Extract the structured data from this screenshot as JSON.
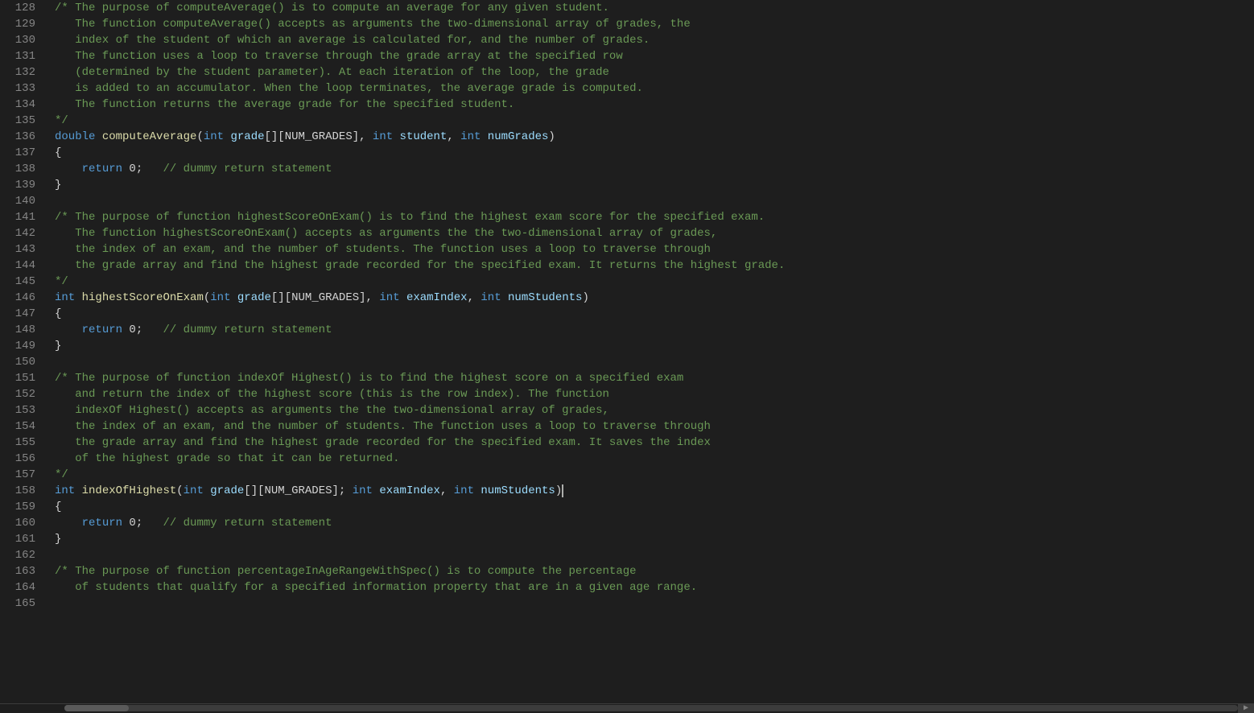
{
  "editor": {
    "background": "#1e1e1e",
    "lines": [
      {
        "num": "128",
        "tokens": [
          {
            "t": "comment",
            "v": "/* The purpose of computeAverage() is to compute an average for any given student."
          }
        ]
      },
      {
        "num": "129",
        "tokens": [
          {
            "t": "comment",
            "v": "   The function computeAverage() accepts as arguments the two-dimensional array of grades, the"
          }
        ]
      },
      {
        "num": "130",
        "tokens": [
          {
            "t": "comment",
            "v": "   index of the student of which an average is calculated for, and the number of grades."
          }
        ]
      },
      {
        "num": "131",
        "tokens": [
          {
            "t": "comment",
            "v": "   The function uses a loop to traverse through the grade array at the specified row"
          }
        ]
      },
      {
        "num": "132",
        "tokens": [
          {
            "t": "comment",
            "v": "   (determined by the student parameter). At each iteration of the loop, the grade"
          }
        ]
      },
      {
        "num": "133",
        "tokens": [
          {
            "t": "comment",
            "v": "   is added to an accumulator. When the loop terminates, the average grade is computed."
          }
        ]
      },
      {
        "num": "134",
        "tokens": [
          {
            "t": "comment",
            "v": "   The function returns the average grade for the specified student."
          }
        ]
      },
      {
        "num": "135",
        "tokens": [
          {
            "t": "comment",
            "v": "*/"
          }
        ]
      },
      {
        "num": "136",
        "tokens": [
          {
            "t": "keyword",
            "v": "double"
          },
          {
            "t": "plain",
            "v": " "
          },
          {
            "t": "function-name",
            "v": "computeAverage"
          },
          {
            "t": "plain",
            "v": "("
          },
          {
            "t": "keyword",
            "v": "int"
          },
          {
            "t": "plain",
            "v": " "
          },
          {
            "t": "param-name",
            "v": "grade"
          },
          {
            "t": "plain",
            "v": "[][NUM_GRADES], "
          },
          {
            "t": "keyword",
            "v": "int"
          },
          {
            "t": "plain",
            "v": " "
          },
          {
            "t": "param-name",
            "v": "student"
          },
          {
            "t": "plain",
            "v": ", "
          },
          {
            "t": "keyword",
            "v": "int"
          },
          {
            "t": "plain",
            "v": " "
          },
          {
            "t": "param-name",
            "v": "numGrades"
          },
          {
            "t": "plain",
            "v": ")"
          }
        ]
      },
      {
        "num": "137",
        "tokens": [
          {
            "t": "plain",
            "v": "{"
          }
        ]
      },
      {
        "num": "138",
        "tokens": [
          {
            "t": "plain",
            "v": "    "
          },
          {
            "t": "keyword",
            "v": "return"
          },
          {
            "t": "plain",
            "v": " 0;   "
          },
          {
            "t": "comment-inline",
            "v": "// dummy return statement"
          }
        ]
      },
      {
        "num": "139",
        "tokens": [
          {
            "t": "plain",
            "v": "}"
          }
        ]
      },
      {
        "num": "140",
        "tokens": []
      },
      {
        "num": "141",
        "tokens": [
          {
            "t": "comment",
            "v": "/* The purpose of function highestScoreOnExam() is to find the highest exam score for the specified exam."
          }
        ]
      },
      {
        "num": "142",
        "tokens": [
          {
            "t": "comment",
            "v": "   The function highestScoreOnExam() accepts as arguments the the two-dimensional array of grades,"
          }
        ]
      },
      {
        "num": "143",
        "tokens": [
          {
            "t": "comment",
            "v": "   the index of an exam, and the number of students. The function uses a loop to traverse through"
          }
        ]
      },
      {
        "num": "144",
        "tokens": [
          {
            "t": "comment",
            "v": "   the grade array and find the highest grade recorded for the specified exam. It returns the highest grade."
          }
        ]
      },
      {
        "num": "145",
        "tokens": [
          {
            "t": "comment",
            "v": "*/"
          }
        ]
      },
      {
        "num": "146",
        "tokens": [
          {
            "t": "keyword",
            "v": "int"
          },
          {
            "t": "plain",
            "v": " "
          },
          {
            "t": "function-name",
            "v": "highestScoreOnExam"
          },
          {
            "t": "plain",
            "v": "("
          },
          {
            "t": "keyword",
            "v": "int"
          },
          {
            "t": "plain",
            "v": " "
          },
          {
            "t": "param-name",
            "v": "grade"
          },
          {
            "t": "plain",
            "v": "[][NUM_GRADES], "
          },
          {
            "t": "keyword",
            "v": "int"
          },
          {
            "t": "plain",
            "v": " "
          },
          {
            "t": "param-name",
            "v": "examIndex"
          },
          {
            "t": "plain",
            "v": ", "
          },
          {
            "t": "keyword",
            "v": "int"
          },
          {
            "t": "plain",
            "v": " "
          },
          {
            "t": "param-name",
            "v": "numStudents"
          },
          {
            "t": "plain",
            "v": ")"
          }
        ]
      },
      {
        "num": "147",
        "tokens": [
          {
            "t": "plain",
            "v": "{"
          }
        ]
      },
      {
        "num": "148",
        "tokens": [
          {
            "t": "plain",
            "v": "    "
          },
          {
            "t": "keyword",
            "v": "return"
          },
          {
            "t": "plain",
            "v": " 0;   "
          },
          {
            "t": "comment-inline",
            "v": "// dummy return statement"
          }
        ]
      },
      {
        "num": "149",
        "tokens": [
          {
            "t": "plain",
            "v": "}"
          }
        ]
      },
      {
        "num": "150",
        "tokens": []
      },
      {
        "num": "151",
        "tokens": [
          {
            "t": "comment",
            "v": "/* The purpose of function indexOf Highest() is to find the highest score on a specified exam"
          }
        ]
      },
      {
        "num": "152",
        "tokens": [
          {
            "t": "comment",
            "v": "   and return the index of the highest score (this is the row index). The function"
          }
        ]
      },
      {
        "num": "153",
        "tokens": [
          {
            "t": "comment",
            "v": "   indexOf Highest() accepts as arguments the the two-dimensional array of grades,"
          }
        ]
      },
      {
        "num": "154",
        "tokens": [
          {
            "t": "comment",
            "v": "   the index of an exam, and the number of students. The function uses a loop to traverse through"
          }
        ]
      },
      {
        "num": "155",
        "tokens": [
          {
            "t": "comment",
            "v": "   the grade array and find the highest grade recorded for the specified exam. It saves the index"
          }
        ]
      },
      {
        "num": "156",
        "tokens": [
          {
            "t": "comment",
            "v": "   of the highest grade so that it can be returned."
          }
        ]
      },
      {
        "num": "157",
        "tokens": [
          {
            "t": "comment",
            "v": "*/"
          }
        ]
      },
      {
        "num": "158",
        "tokens": [
          {
            "t": "keyword",
            "v": "int"
          },
          {
            "t": "plain",
            "v": " "
          },
          {
            "t": "function-name",
            "v": "indexOfHighest"
          },
          {
            "t": "plain",
            "v": "("
          },
          {
            "t": "keyword",
            "v": "int"
          },
          {
            "t": "plain",
            "v": " "
          },
          {
            "t": "param-name",
            "v": "grade"
          },
          {
            "t": "plain",
            "v": "[][NUM_GRADES]; "
          },
          {
            "t": "keyword",
            "v": "int"
          },
          {
            "t": "plain",
            "v": " "
          },
          {
            "t": "param-name",
            "v": "examIndex"
          },
          {
            "t": "plain",
            "v": ", "
          },
          {
            "t": "keyword",
            "v": "int"
          },
          {
            "t": "plain",
            "v": " "
          },
          {
            "t": "param-name",
            "v": "numStudents"
          },
          {
            "t": "plain",
            "v": ")"
          }
        ]
      },
      {
        "num": "159",
        "tokens": [
          {
            "t": "plain",
            "v": "{"
          }
        ]
      },
      {
        "num": "160",
        "tokens": [
          {
            "t": "plain",
            "v": "    "
          },
          {
            "t": "keyword",
            "v": "return"
          },
          {
            "t": "plain",
            "v": " 0;   "
          },
          {
            "t": "comment-inline",
            "v": "// dummy return statement"
          }
        ]
      },
      {
        "num": "161",
        "tokens": [
          {
            "t": "plain",
            "v": "}"
          }
        ]
      },
      {
        "num": "162",
        "tokens": []
      },
      {
        "num": "163",
        "tokens": [
          {
            "t": "comment",
            "v": "/* The purpose of function percentageInAgeRangeWithSpec() is to compute the percentage"
          }
        ]
      },
      {
        "num": "164",
        "tokens": [
          {
            "t": "comment",
            "v": "   of students that qualify for a specified information property that are in a given age range."
          }
        ]
      },
      {
        "num": "165",
        "tokens": []
      }
    ],
    "cursor_line": 158,
    "cursor_col": 505
  },
  "scrollbar": {
    "label": "horizontal-scrollbar"
  }
}
